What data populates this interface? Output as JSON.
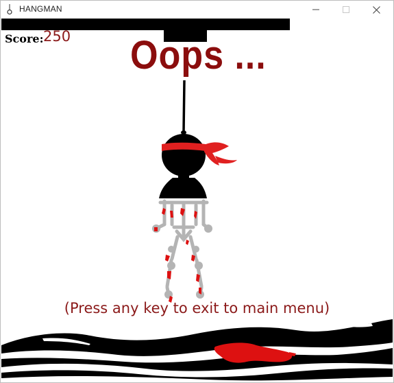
{
  "window": {
    "title": "HANGMAN",
    "icon": "noose-icon",
    "controls": [
      "minimize-icon",
      "maximize-icon",
      "close-icon"
    ]
  },
  "game": {
    "score_label": "Score:",
    "score_value": "250",
    "headline": "Oops ...",
    "prompt": "(Press any key to exit to main menu)"
  },
  "colors": {
    "headline": "#8b0d0d",
    "score_value": "#8b1a1a",
    "prompt": "#8b1a1a",
    "headband": "#e02020",
    "blood": "#dd1111",
    "skeleton": "#b4b4b4",
    "ink": "#000000"
  }
}
